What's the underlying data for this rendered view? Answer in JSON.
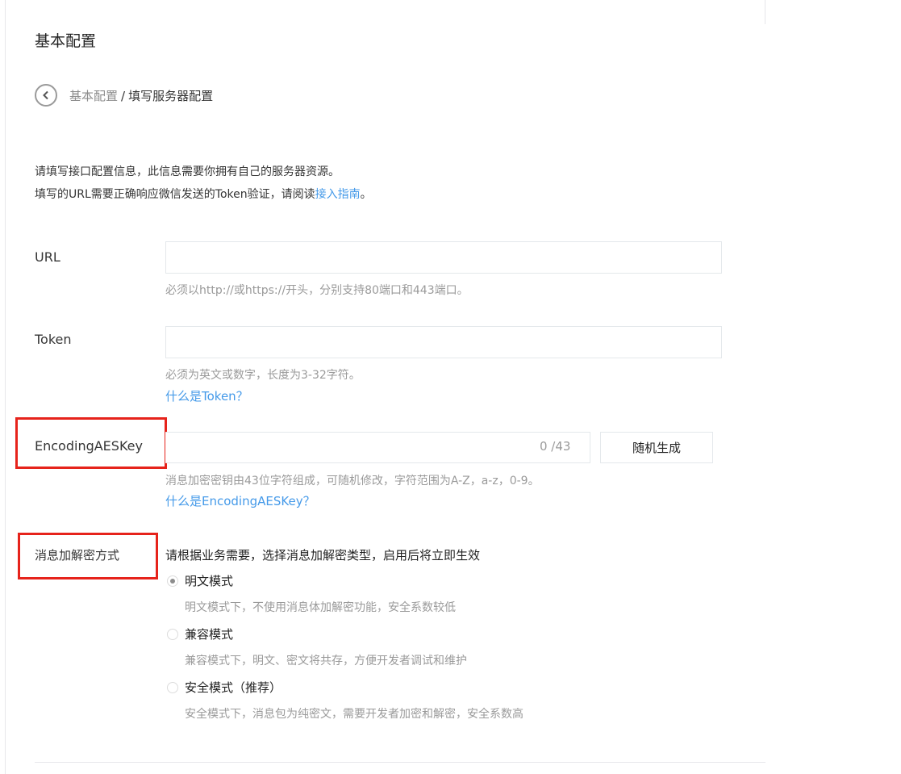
{
  "page_title": "基本配置",
  "breadcrumb": {
    "parent": "基本配置",
    "separator": "/",
    "current": "填写服务器配置"
  },
  "intro": {
    "line1": "请填写接口配置信息，此信息需要你拥有自己的服务器资源。",
    "line2_prefix": "填写的URL需要正确响应微信发送的Token验证，请阅读",
    "line2_link": "接入指南",
    "line2_suffix": "。"
  },
  "fields": {
    "url": {
      "label": "URL",
      "value": "",
      "tip": "必须以http://或https://开头，分别支持80端口和443端口。"
    },
    "token": {
      "label": "Token",
      "value": "",
      "tip": "必须为英文或数字，长度为3-32字符。",
      "help_link": "什么是Token？"
    },
    "aeskey": {
      "label": "EncodingAESKey",
      "value": "",
      "counter": "0 /43",
      "generate_button": "随机生成",
      "tip": "消息加密密钥由43位字符组成，可随机修改，字符范围为A-Z，a-z，0-9。",
      "help_link": "什么是EncodingAESKey？"
    },
    "encrypt_mode": {
      "label": "消息加解密方式",
      "description": "请根据业务需要，选择消息加解密类型，启用后将立即生效",
      "options": [
        {
          "label": "明文模式",
          "desc": "明文模式下，不使用消息体加解密功能，安全系数较低",
          "checked": true
        },
        {
          "label": "兼容模式",
          "desc": "兼容模式下，明文、密文将共存，方便开发者调试和维护",
          "checked": false
        },
        {
          "label": "安全模式（推荐）",
          "desc": "安全模式下，消息包为纯密文，需要开发者加密和解密，安全系数高",
          "checked": false
        }
      ]
    }
  },
  "colors": {
    "link": "#459ae9",
    "highlight": "#e6231b",
    "muted_text": "#9a9a9a",
    "border": "#e4e8eb"
  }
}
